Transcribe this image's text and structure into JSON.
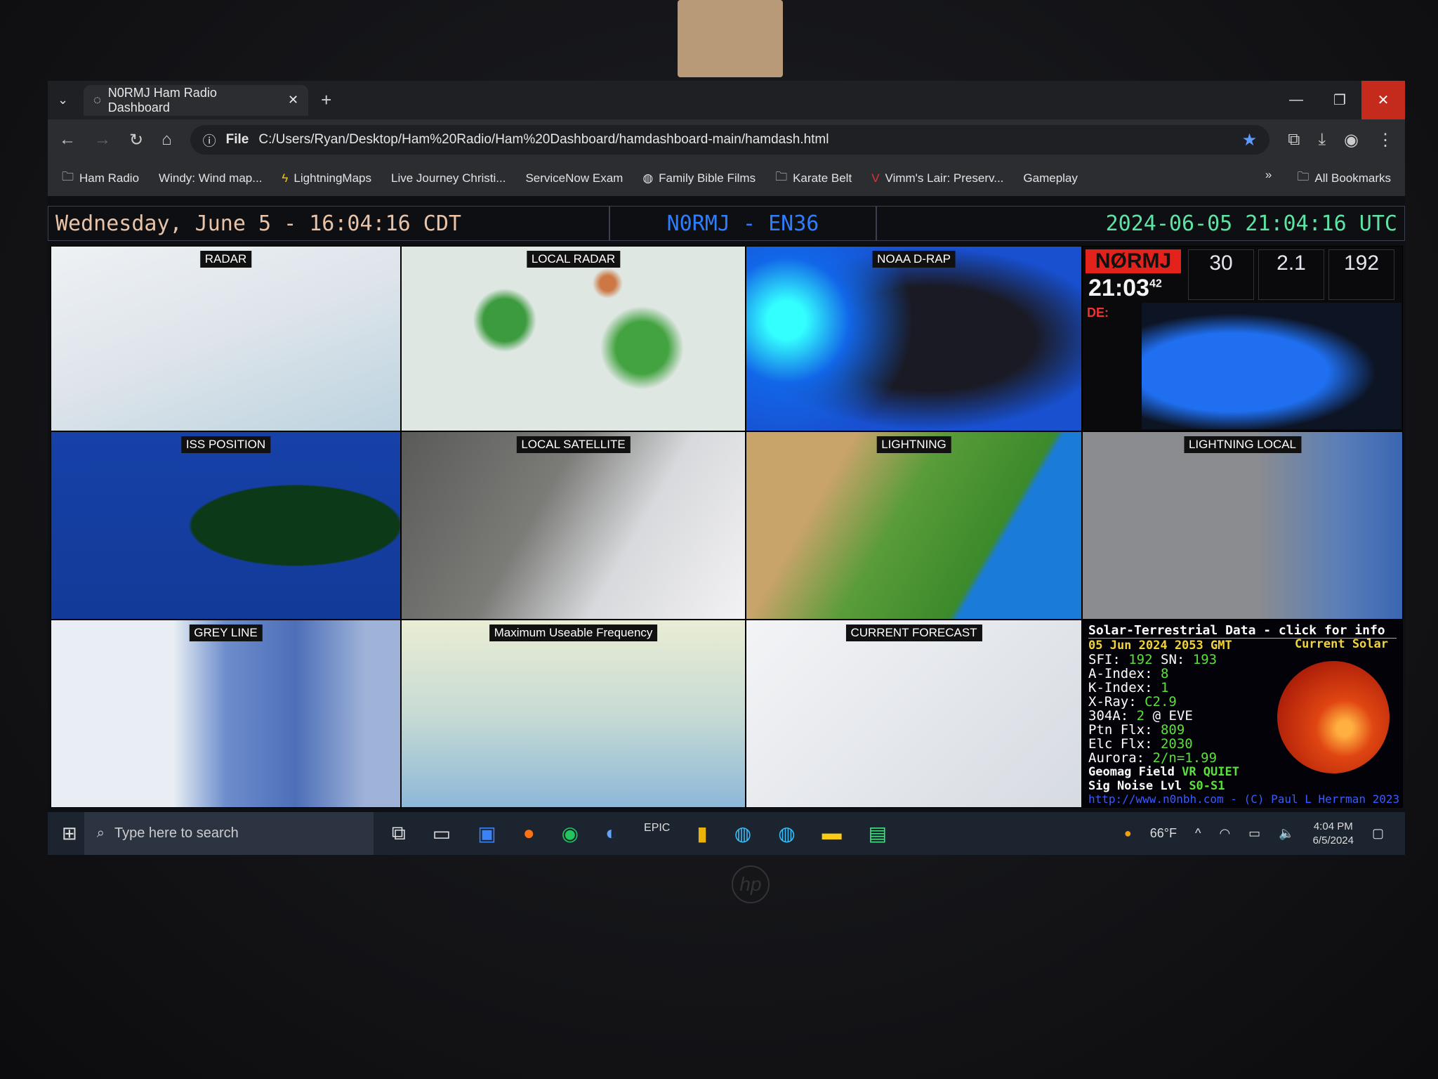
{
  "browser": {
    "tab_title": "N0RMJ Ham Radio Dashboard",
    "url_scheme": "File",
    "url": "C:/Users/Ryan/Desktop/Ham%20Radio/Ham%20Dashboard/hamdashboard-main/hamdash.html",
    "bookmarks": [
      "Ham Radio",
      "Windy: Wind map...",
      "LightningMaps",
      "Live Journey Christi...",
      "ServiceNow Exam",
      "Family Bible Films",
      "Karate Belt",
      "Vimm's Lair: Preserv...",
      "Gameplay"
    ],
    "all_bookmarks": "All Bookmarks",
    "overflow": "»"
  },
  "header": {
    "local_time": "Wednesday, June 5 - 16:04:16 CDT",
    "callsign_grid": "N0RMJ - EN36",
    "utc_time": "2024-06-05 21:04:16 UTC"
  },
  "panels": [
    "RADAR",
    "LOCAL RADAR",
    "NOAA D-RAP",
    "LIGHTNING LOCAL",
    "ISS POSITION",
    "LOCAL SATELLITE",
    "LIGHTNING",
    "GREY LINE",
    "Maximum Useable Frequency",
    "CURRENT FORECAST"
  ],
  "hamclock": {
    "callsign": "NØRMJ",
    "time": "21:03",
    "seconds": "42",
    "de": "DE:",
    "stats": [
      "30",
      "2.1",
      "192"
    ]
  },
  "solar": {
    "title": "Solar-Terrestrial Data - click for info",
    "date": "05 Jun 2024 2053 GMT",
    "current_solar": "Current Solar",
    "rows": [
      {
        "k": "SFI:",
        "v": "192",
        "k2": "SN:",
        "v2": "193"
      },
      {
        "k": "A-Index:",
        "v": "8"
      },
      {
        "k": "K-Index:",
        "v": "1"
      },
      {
        "k": "X-Ray:",
        "v": "C2.9"
      },
      {
        "k": "304A:",
        "v": "2",
        "k2": "@ EVE"
      },
      {
        "k": "Ptn Flx:",
        "v": "809"
      },
      {
        "k": "Elc Flx:",
        "v": "2030"
      },
      {
        "k": "Aurora:",
        "v": "2/n=1.99"
      },
      {
        "k": "Geomag Field",
        "v": "VR QUIET"
      },
      {
        "k": "Sig Noise Lvl",
        "v": "S0-S1"
      }
    ],
    "footer": "http://www.n0nbh.com - (C) Paul L Herrman 2023"
  },
  "taskbar": {
    "search_placeholder": "Type here to search",
    "temp": "66°F",
    "time": "4:04 PM",
    "date": "6/5/2024"
  },
  "colors": {
    "accent_blue": "#2f7dff",
    "utc_green": "#5fe3a5",
    "local_peach": "#e9c3a7",
    "solar_green": "#5be03c",
    "solar_yellow": "#f2d33c",
    "close_red": "#c42b1c"
  }
}
